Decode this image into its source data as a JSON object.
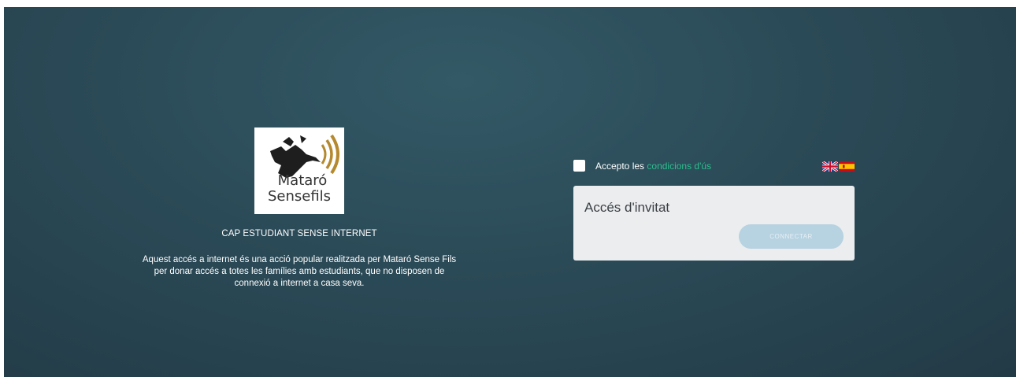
{
  "brand": {
    "logo_line1": "Mataró",
    "logo_line2": "Sensefils"
  },
  "info": {
    "heading": "CAP ESTUDIANT SENSE INTERNET",
    "description_line1": "Aquest accés a internet és una acció popular realitzada per Mataró Sense Fils",
    "description_line2": "per donar accés a totes les famílies amb estudiants, que no disposen de",
    "description_line3": "connexió a internet a casa seva."
  },
  "terms": {
    "checked": false,
    "prefix": "Accepto les",
    "link": "condicions d'ús"
  },
  "languages": [
    {
      "name": "english-flag-icon"
    },
    {
      "name": "spanish-flag-icon"
    }
  ],
  "guest": {
    "title": "Accés d'invitat",
    "button": "CONNECTAR"
  },
  "colors": {
    "background": "#2b4a57",
    "link": "#2bbf8c",
    "button": "#b7d2e0",
    "panel": "#ebedef"
  }
}
